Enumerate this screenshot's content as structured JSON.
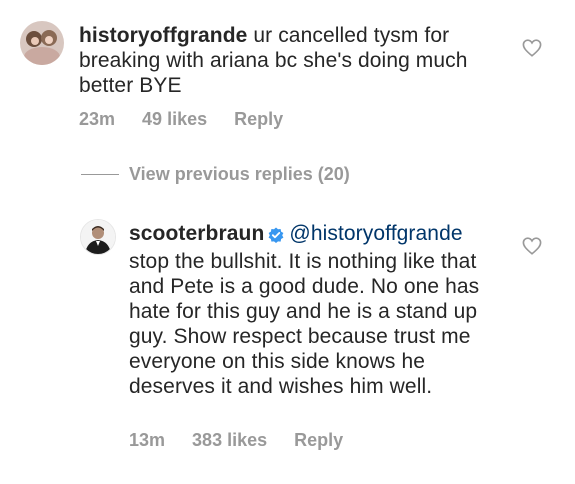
{
  "comments": [
    {
      "username": "historyoffgrande",
      "text": "ur cancelled tysm for breaking with ariana bc she's doing much better BYE",
      "time": "23m",
      "likes": "49 likes",
      "reply_label": "Reply"
    }
  ],
  "replies_toggle": {
    "label": "View previous replies (20)"
  },
  "reply": {
    "username": "scooterbraun",
    "mention": "@historyoffgrande",
    "text": "stop the bullshit. It is nothing like that and Pete is a good dude. No one has hate for this guy and he is a stand up guy. Show respect because trust me everyone on this side knows he deserves it and wishes him well.",
    "time": "13m",
    "likes": "383 likes",
    "reply_label": "Reply"
  },
  "colors": {
    "text": "#262626",
    "meta": "#999999",
    "mention": "#003569",
    "verified": "#3897f0"
  },
  "icons": [
    "avatar-image",
    "heart-icon",
    "verified-badge-icon"
  ]
}
